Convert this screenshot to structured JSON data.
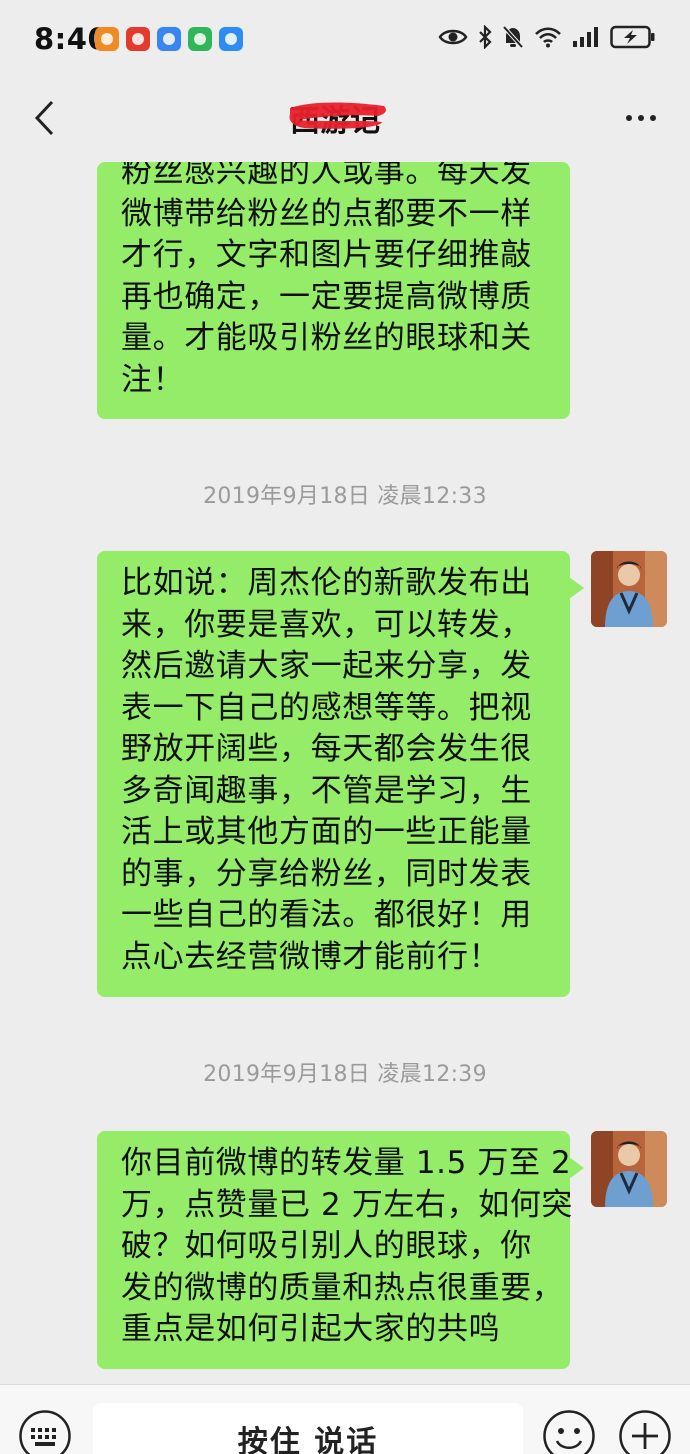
{
  "status_bar": {
    "time": "8:40",
    "notification_icons": [
      {
        "name": "lion-app-icon",
        "color": "#f08a24"
      },
      {
        "name": "bank-app-icon",
        "color": "#e23b2e"
      },
      {
        "name": "message-app-icon",
        "color": "#3a86f0"
      },
      {
        "name": "green-app-icon",
        "color": "#2fb55a"
      },
      {
        "name": "cloud-app-icon",
        "color": "#2f8cf2"
      }
    ],
    "system_icons": [
      "eye-icon",
      "bluetooth-icon",
      "mute-icon",
      "wifi-icon",
      "signal-icon",
      "battery-charging-icon"
    ]
  },
  "nav": {
    "title": "西游记",
    "back_icon": "chevron-left-icon",
    "more_icon": "more-dots-icon"
  },
  "colors": {
    "background": "#ededed",
    "bubble_green": "#95ec69",
    "timestamp_gray": "#9a9a9a",
    "redaction_red": "#e8212a"
  },
  "messages": [
    {
      "type": "sent",
      "lines": [
        "粉丝感兴趣的人或事。每天发",
        "微博带给粉丝的点都要不一样",
        "才行，文字和图片要仔细推敲",
        "再也确定，一定要提高微博质",
        "量。才能吸引粉丝的眼球和关",
        "注！"
      ]
    },
    {
      "type": "timestamp",
      "text": "2019年9月18日 凌晨12:33"
    },
    {
      "type": "sent",
      "lines": [
        "比如说：周杰伦的新歌发布出",
        "来，你要是喜欢，可以转发，",
        "然后邀请大家一起来分享，发",
        "表一下自己的感想等等。把视",
        "野放开阔些，每天都会发生很",
        "多奇闻趣事，不管是学习，生",
        "活上或其他方面的一些正能量",
        "的事，分享给粉丝，同时发表",
        "一些自己的看法。都很好！用",
        "点心去经营微博才能前行！"
      ]
    },
    {
      "type": "timestamp",
      "text": "2019年9月18日 凌晨12:39"
    },
    {
      "type": "sent",
      "lines": [
        "你目前微博的转发量 1.5 万至 2",
        "万，点赞量已 2 万左右，如何突",
        "破？如何吸引别人的眼球，你",
        "发的微博的质量和热点很重要，",
        "重点是如何引起大家的共鸣"
      ]
    }
  ],
  "input_bar": {
    "voice_label": "按住 说话",
    "keyboard_icon": "keyboard-icon",
    "emoji_icon": "emoji-icon",
    "plus_icon": "plus-icon"
  }
}
